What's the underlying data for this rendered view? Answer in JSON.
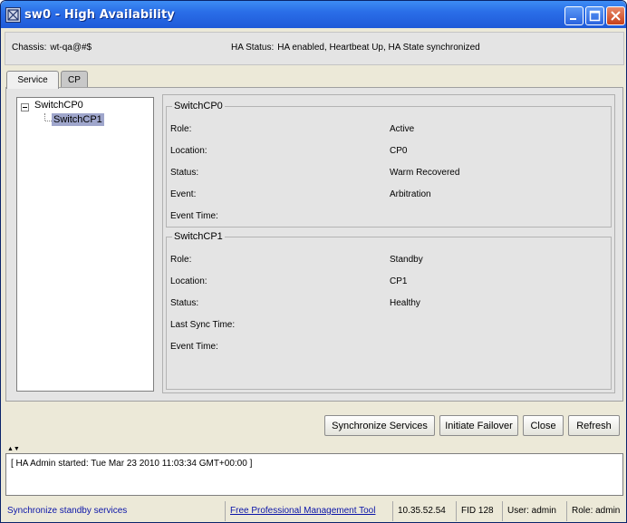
{
  "window": {
    "title": "sw0 - High Availability"
  },
  "info": {
    "chassis_label": "Chassis:",
    "chassis_value": "wt-qa@#$",
    "ha_status_label": "HA Status:",
    "ha_status_value": "HA enabled, Heartbeat Up, HA State synchronized"
  },
  "tabs": [
    {
      "label": "Service",
      "active": true
    },
    {
      "label": "CP",
      "active": false
    }
  ],
  "tree": {
    "root": "SwitchCP0",
    "child": "SwitchCP1",
    "child_selected": true
  },
  "cp0": {
    "title": "SwitchCP0",
    "rows": [
      {
        "label": "Role:",
        "value": "Active"
      },
      {
        "label": "Location:",
        "value": "CP0"
      },
      {
        "label": "Status:",
        "value": "Warm Recovered"
      },
      {
        "label": "Event:",
        "value": "Arbitration"
      },
      {
        "label": "Event Time:",
        "value": ""
      }
    ]
  },
  "cp1": {
    "title": "SwitchCP1",
    "rows": [
      {
        "label": "Role:",
        "value": "Standby"
      },
      {
        "label": "Location:",
        "value": "CP1"
      },
      {
        "label": "Status:",
        "value": "Healthy"
      },
      {
        "label": "Last Sync Time:",
        "value": ""
      },
      {
        "label": "Event Time:",
        "value": ""
      }
    ]
  },
  "buttons": {
    "sync": "Synchronize Services",
    "failover": "Initiate Failover",
    "close": "Close",
    "refresh": "Refresh"
  },
  "log": {
    "text": "[ HA Admin started: Tue Mar 23 2010 11:03:34 GMT+00:00 ]"
  },
  "status": {
    "message": "Synchronize standby services",
    "link": "Free Professional Management Tool",
    "ip": "10.35.52.54",
    "fid": "FID 128",
    "user": "User: admin",
    "role": "Role: admin"
  },
  "colors": {
    "titlebar": "#2a6ee8",
    "selection": "#9fa6cc",
    "link": "#0a14a8"
  }
}
